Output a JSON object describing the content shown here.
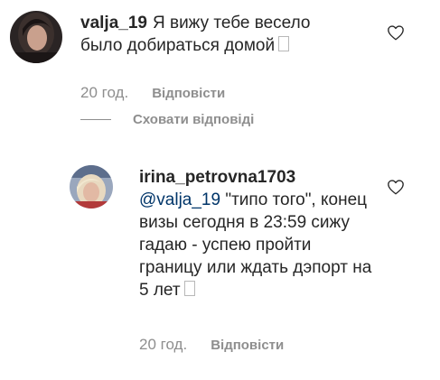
{
  "comments": [
    {
      "username": "valja_19",
      "text": "Я вижу тебе весело было добираться домой",
      "time": "20 год.",
      "reply_label": "Відповісти"
    }
  ],
  "hide_replies_label": "Сховати відповіді",
  "replies": [
    {
      "username": "irina_petrovna1703",
      "mention": "@valja_19",
      "text": "\"типо того\", конец визы сегодня в 23:59 сижу гадаю - успею пройти границу или ждать дэпорт на 5 лет",
      "time": "20 год.",
      "reply_label": "Відповісти"
    }
  ],
  "icons": {
    "like": "heart-icon"
  },
  "colors": {
    "text": "#262626",
    "muted": "#8e8e8e",
    "mention": "#003569"
  }
}
